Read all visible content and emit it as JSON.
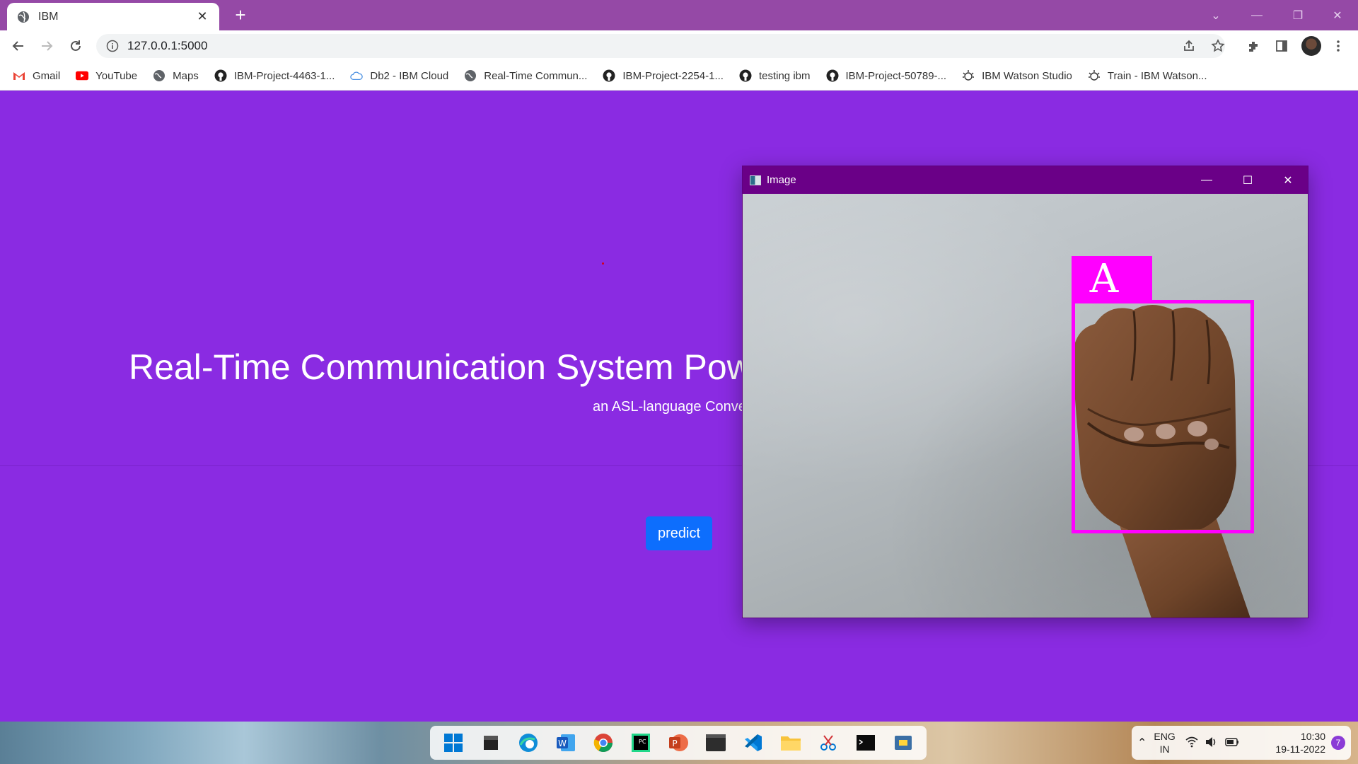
{
  "browser": {
    "tab_title": "IBM",
    "new_tab_symbol": "+",
    "tab_close_symbol": "✕",
    "url": "127.0.0.1:5000",
    "bookmarks": [
      {
        "label": "Gmail",
        "icon": "gmail-icon"
      },
      {
        "label": "YouTube",
        "icon": "youtube-icon"
      },
      {
        "label": "Maps",
        "icon": "globe-icon"
      },
      {
        "label": "IBM-Project-4463-1...",
        "icon": "github-icon"
      },
      {
        "label": "Db2 - IBM Cloud",
        "icon": "cloud-icon"
      },
      {
        "label": "Real-Time Commun...",
        "icon": "globe-icon"
      },
      {
        "label": "IBM-Project-2254-1...",
        "icon": "github-icon"
      },
      {
        "label": "testing ibm",
        "icon": "github-icon"
      },
      {
        "label": "IBM-Project-50789-...",
        "icon": "github-icon"
      },
      {
        "label": "IBM Watson Studio",
        "icon": "watson-icon"
      },
      {
        "label": "Train - IBM Watson...",
        "icon": "watson-icon"
      }
    ]
  },
  "page": {
    "title": "Real-Time Communication System Pow",
    "subtitle": "an ASL-language Conve",
    "predict_label": "predict",
    "background_color": "#8a2be2",
    "button_color": "#0d6efd"
  },
  "image_window": {
    "title": "Image",
    "detected_letter": "A",
    "box_color": "#ff00ff"
  },
  "taskbar": {
    "apps": [
      "windows-start-icon",
      "file-icon",
      "edge-icon",
      "word-icon",
      "chrome-icon",
      "pycharm-icon",
      "powerpoint-icon",
      "terminal-icon",
      "vscode-icon",
      "folder-icon",
      "snipping-tool-icon",
      "cmd-icon",
      "python-icon"
    ],
    "lang_top": "ENG",
    "lang_bottom": "IN",
    "time": "10:30",
    "date": "19-11-2022",
    "notification_count": "7"
  }
}
